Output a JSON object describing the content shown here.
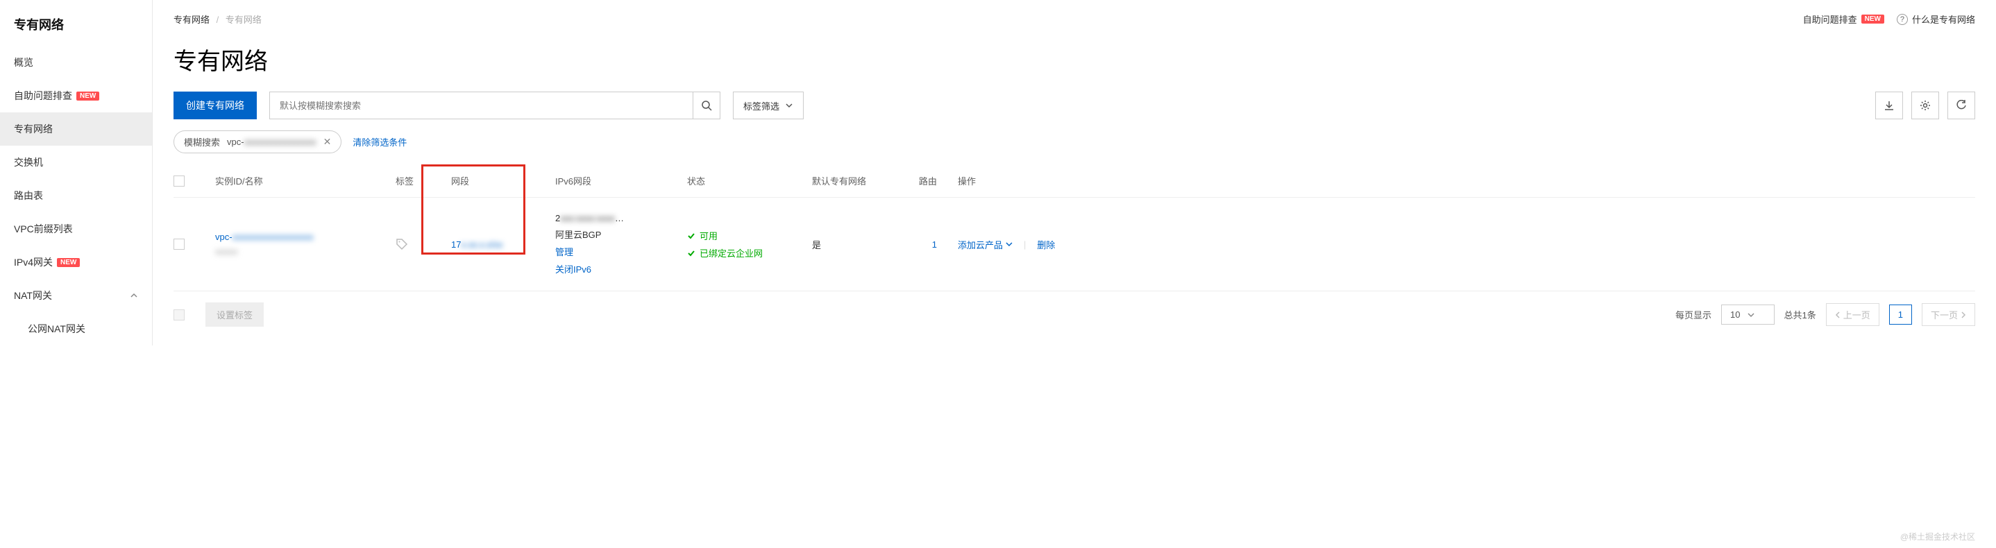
{
  "sidebar": {
    "title": "专有网络",
    "items": [
      {
        "label": "概览",
        "active": false
      },
      {
        "label": "自助问题排查",
        "new": true
      },
      {
        "label": "专有网络",
        "active": true
      },
      {
        "label": "交换机"
      },
      {
        "label": "路由表"
      },
      {
        "label": "VPC前缀列表"
      },
      {
        "label": "IPv4网关",
        "new": true
      },
      {
        "label": "NAT网关",
        "expandable": true
      }
    ],
    "subitem": "公网NAT网关",
    "new_badge": "NEW"
  },
  "breadcrumb": {
    "root": "专有网络",
    "current": "专有网络"
  },
  "header_links": {
    "self_diag": "自助问题排查",
    "what_is": "什么是专有网络"
  },
  "page_title": "专有网络",
  "toolbar": {
    "create_btn": "创建专有网络",
    "search_placeholder": "默认按模糊搜索搜索",
    "tag_filter": "标签筛选"
  },
  "filter": {
    "chip_label": "模糊搜索",
    "chip_value": "vpc-",
    "clear": "清除筛选条件"
  },
  "columns": {
    "id": "实例ID/名称",
    "tag": "标签",
    "cidr": "网段",
    "ipv6": "IPv6网段",
    "status": "状态",
    "default": "默认专有网络",
    "route": "路由",
    "actions": "操作"
  },
  "row": {
    "id_link": "vpc-",
    "cidr": "17",
    "ipv6_line1": "2",
    "ipv6_bgp": "阿里云BGP",
    "ipv6_manage": "管理",
    "ipv6_close": "关闭IPv6",
    "status_avail": "可用",
    "status_bound": "已绑定云企业网",
    "is_default": "是",
    "route_count": "1",
    "action_add": "添加云产品",
    "action_delete": "删除"
  },
  "footer": {
    "set_tag": "设置标签",
    "per_page": "每页显示",
    "page_size": "10",
    "total": "总共1条",
    "prev": "上一页",
    "page": "1",
    "next": "下一页"
  },
  "watermark": "@稀土掘金技术社区"
}
